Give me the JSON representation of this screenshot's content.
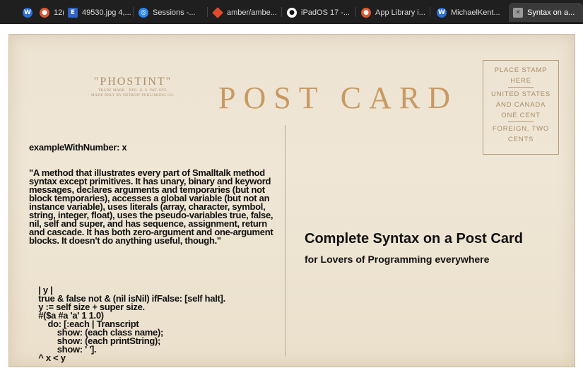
{
  "tabs": [
    {
      "label": "",
      "icon": "wordpress-icon",
      "color": "#2b6fd6"
    },
    {
      "label": "12(",
      "icon": "duckduckgo-icon",
      "color": "#de5833"
    },
    {
      "label": "49530.jpg 4,...",
      "icon": "e-icon",
      "color": "#2f63c4"
    },
    {
      "label": "Sessions -...",
      "icon": "safari-icon",
      "color": "#2c86f0"
    },
    {
      "label": "amber/ambe...",
      "icon": "git-icon",
      "color": "#e24a2a"
    },
    {
      "label": "iPadOS 17 -...",
      "icon": "apple-icon",
      "color": "#ffffff"
    },
    {
      "label": "App Library i...",
      "icon": "duckduckgo-icon",
      "color": "#de5833"
    },
    {
      "label": "MichaelKent...",
      "icon": "wordpress-icon",
      "color": "#2b6fd6"
    },
    {
      "label": "Syntax on a...",
      "icon": "close-icon",
      "color": "#9a9a9a"
    }
  ],
  "postcard": {
    "brand": "\"PHOSTINT\"",
    "brand_sub1": "TRADE MARK · REG. U. S. PAT. OFF.",
    "brand_sub2": "MADE ONLY BY DETROIT PUBLISHING CO.",
    "title": "POST CARD",
    "stamp": {
      "l1": "PLACE STAMP",
      "l2": "HERE",
      "l3": "UNITED STATES",
      "l4": "AND CANADA",
      "l5": "ONE CENT",
      "l6": "FOREIGN, TWO",
      "l7": "CENTS"
    },
    "code": {
      "signature": "exampleWithNumber: x",
      "comment": "\"A method that illustrates every part of Smalltalk method syntax except primitives. It has unary, binary and keyword messages, declares arguments and temporaries (but not block temporaries), accesses a global variable (but not an instance variable), uses literals (array, character, symbol, string, integer, float), uses the pseudo-variables true, false, nil, self and super, and has sequence, assignment, return and cascade. It has both zero-argument and one-argument blocks. It doesn't do anything useful, though.\"",
      "body": "    | y |\n    true & false not & (nil isNil) ifFalse: [self halt].\n    y := self size + super size.\n    #($a #a 'a' 1 1.0)\n        do: [:each | Transcript\n            show: (each class name);\n            show: (each printString);\n            show: ' '].\n    ^ x < y"
    },
    "headline": "Complete Syntax on a Post Card",
    "subline": "for Lovers of Programming everywhere"
  }
}
